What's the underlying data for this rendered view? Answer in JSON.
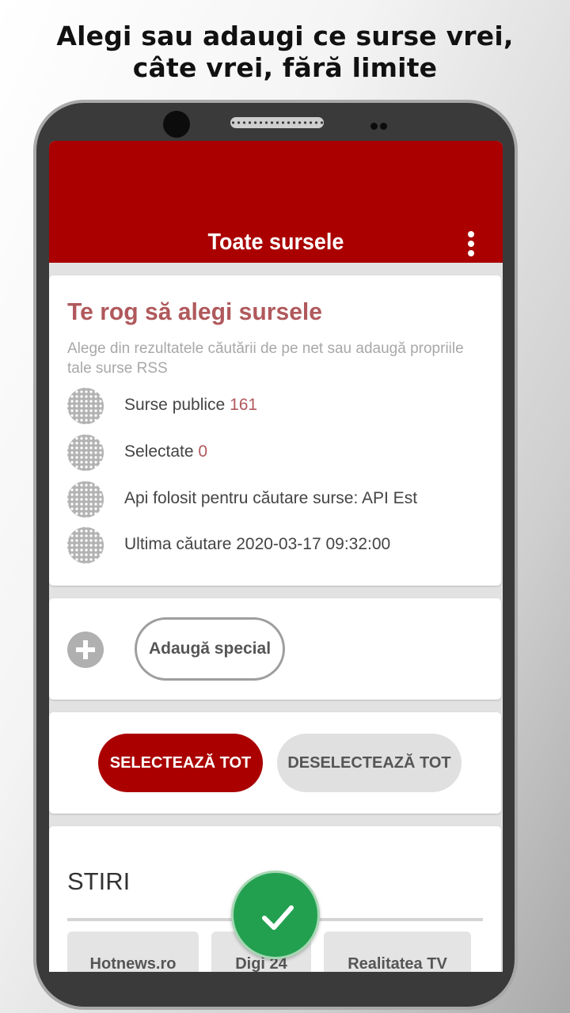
{
  "promo": {
    "line1": "Alegi sau adaugi ce surse vrei,",
    "line2": "câte vrei, fără limite"
  },
  "appbar": {
    "title": "Toate sursele",
    "menu_icon": "more-vert-icon"
  },
  "info_card": {
    "title": "Te rog să alegi sursele",
    "subtitle": "Alege din rezultatele căutării de pe net sau adaugă propriile tale surse RSS",
    "rows": [
      {
        "label": "Surse publice ",
        "value": "161",
        "icon": "dots-grid-icon"
      },
      {
        "label": "Selectate ",
        "value": "0",
        "icon": "dots-grid-icon"
      },
      {
        "label": "Api folosit pentru căutare surse: API Est",
        "value": "",
        "icon": "dots-grid-icon"
      },
      {
        "label": "Ultima căutare 2020-03-17 09:32:00",
        "value": "",
        "icon": "dots-grid-icon"
      }
    ]
  },
  "add_card": {
    "add_icon": "plus-icon",
    "special_label": "Adaugă special"
  },
  "selection": {
    "select_all": "SELECTEAZĂ TOT",
    "deselect_all": "DESELECTEAZĂ TOT"
  },
  "category": {
    "title": "STIRI",
    "chips": [
      "Hotnews.ro",
      "Digi 24",
      "Realitatea TV"
    ]
  },
  "fab": {
    "icon": "check-icon"
  },
  "colors": {
    "accent": "#aa0000",
    "title_color": "#b0595c",
    "fab": "#22a050"
  }
}
